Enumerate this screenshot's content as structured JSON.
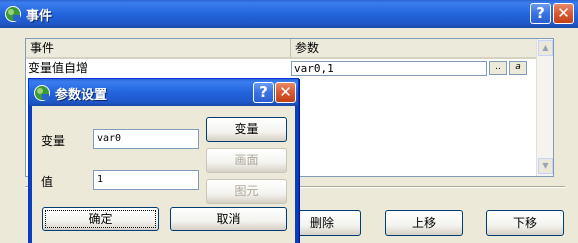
{
  "window": {
    "title": "事件",
    "help_btn": "?",
    "close_btn": "✕"
  },
  "table": {
    "columns": [
      "事件",
      "参数"
    ],
    "rows": [
      {
        "event": "变量值自增",
        "param": "var0,1",
        "btn1": "..",
        "btn2": "a"
      }
    ]
  },
  "main_buttons": {
    "delete": "删除",
    "move_up": "上移",
    "move_down": "下移"
  },
  "dialog": {
    "title": "参数设置",
    "help_btn": "?",
    "close_btn": "✕",
    "var_label": "变量",
    "var_value": "var0",
    "val_label": "值",
    "val_value": "1",
    "btn_var": "变量",
    "btn_screen": "画面",
    "btn_element": "图元",
    "ok": "确定",
    "cancel": "取消"
  }
}
